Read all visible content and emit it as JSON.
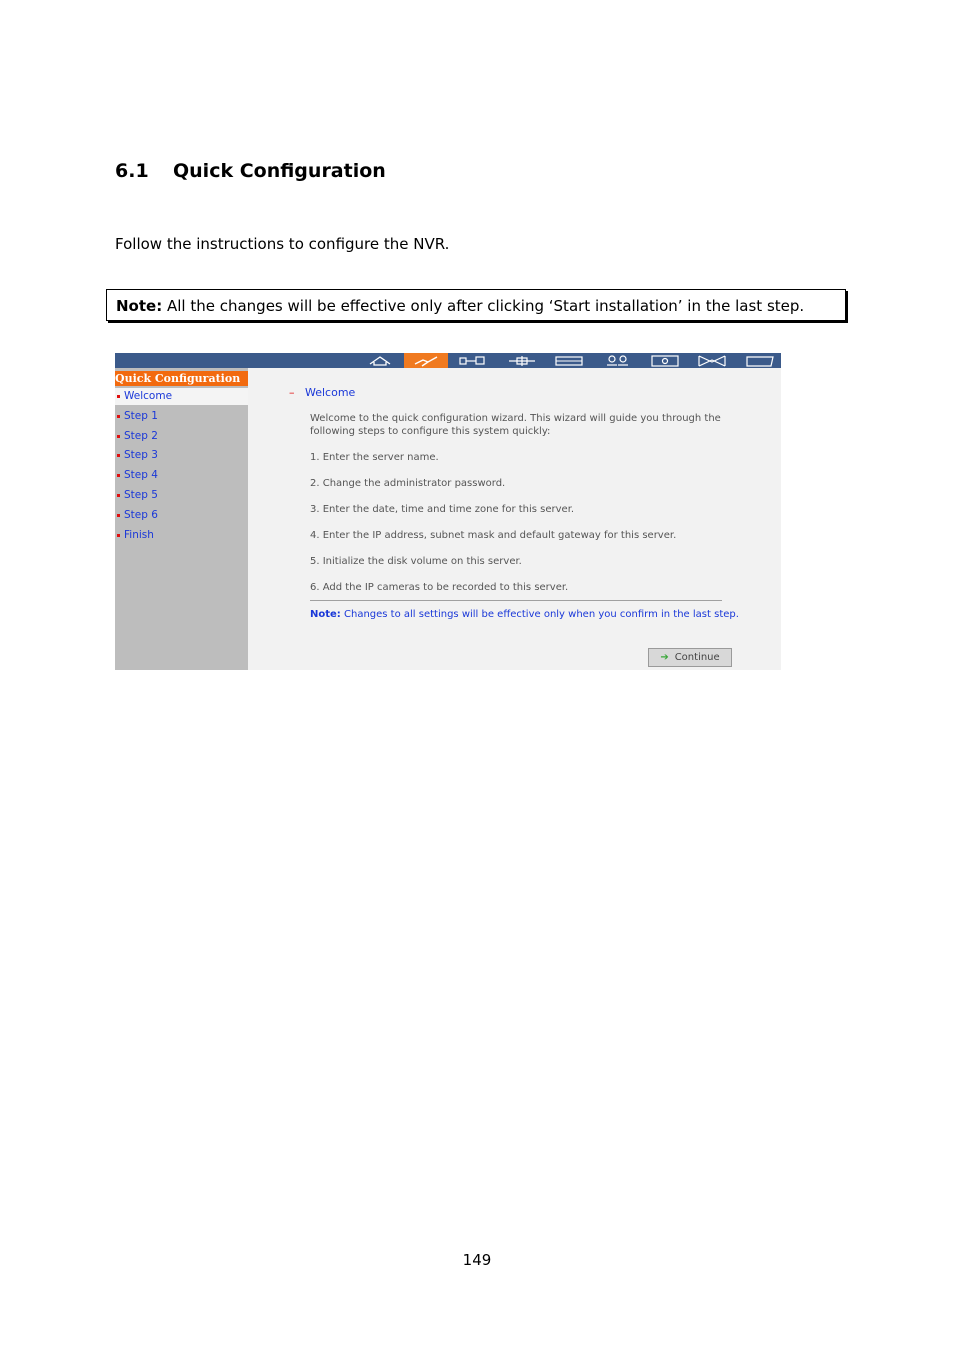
{
  "section": {
    "number": "6.1",
    "title": "Quick Configuration"
  },
  "intro": "Follow the instructions to configure the NVR.",
  "note": {
    "label": "Note:",
    "text": "All the changes will be effective only after clicking ‘Start installation’ in the last step."
  },
  "app": {
    "toolbar": {
      "icons": [
        "home-icon",
        "quick-config-icon",
        "system-tools-icon",
        "network-icon",
        "disk-icon",
        "users-icon",
        "camera-icon",
        "event-icon",
        "logs-icon"
      ],
      "active_index": 1
    },
    "sidebar": {
      "title": "Quick Configuration",
      "items": [
        {
          "label": "Welcome",
          "current": true
        },
        {
          "label": "Step 1"
        },
        {
          "label": "Step 2"
        },
        {
          "label": "Step 3"
        },
        {
          "label": "Step 4"
        },
        {
          "label": "Step 5"
        },
        {
          "label": "Step 6"
        },
        {
          "label": "Finish"
        }
      ]
    },
    "content": {
      "title_marker": "–",
      "title": "Welcome",
      "intro": "Welcome to the quick configuration wizard. This wizard will guide you through the following steps to configure this system quickly:",
      "steps": [
        "1. Enter the server name.",
        "2. Change the administrator password.",
        "3. Enter the date, time and time zone for this server.",
        "4. Enter the IP address, subnet mask and default gateway for this server.",
        "5. Initialize the disk volume on this server.",
        "6. Add the IP cameras to be recorded to this server."
      ],
      "note_label": "Note:",
      "note_text": "Changes to all settings will be effective only when you confirm in the last step.",
      "continue_label": "Continue"
    }
  },
  "page_number": "149"
}
